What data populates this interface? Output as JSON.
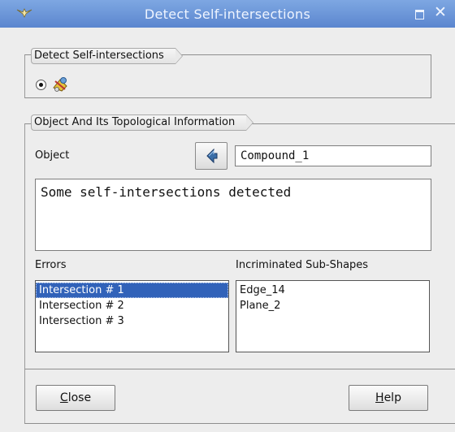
{
  "window": {
    "title": "Detect Self-intersections",
    "icon": "pin-icon",
    "controls": [
      "maximize-icon",
      "close-icon"
    ]
  },
  "type_group": {
    "label": "Detect Self-intersections",
    "radio_selected": true,
    "radio_icon": "self-intersection-shape-icon"
  },
  "object_group": {
    "label": "Object And Its Topological Information",
    "object_label": "Object",
    "select_icon": "arrow-select-icon",
    "object_value": "Compound_1",
    "result_text": "Some self-intersections detected",
    "errors_label": "Errors",
    "errors": [
      {
        "label": "Intersection # 1",
        "selected": true
      },
      {
        "label": "Intersection # 2",
        "selected": false
      },
      {
        "label": "Intersection # 3",
        "selected": false
      }
    ],
    "subshapes_label": "Incriminated Sub-Shapes",
    "subshapes": [
      "Edge_14",
      "Plane_2"
    ]
  },
  "buttons": {
    "close_mnemonic": "C",
    "close_rest": "lose",
    "help_mnemonic": "H",
    "help_rest": "elp"
  },
  "colors": {
    "titlebar": "#5b86cf",
    "selection": "#3162b9",
    "dialog_bg": "#ededed"
  }
}
